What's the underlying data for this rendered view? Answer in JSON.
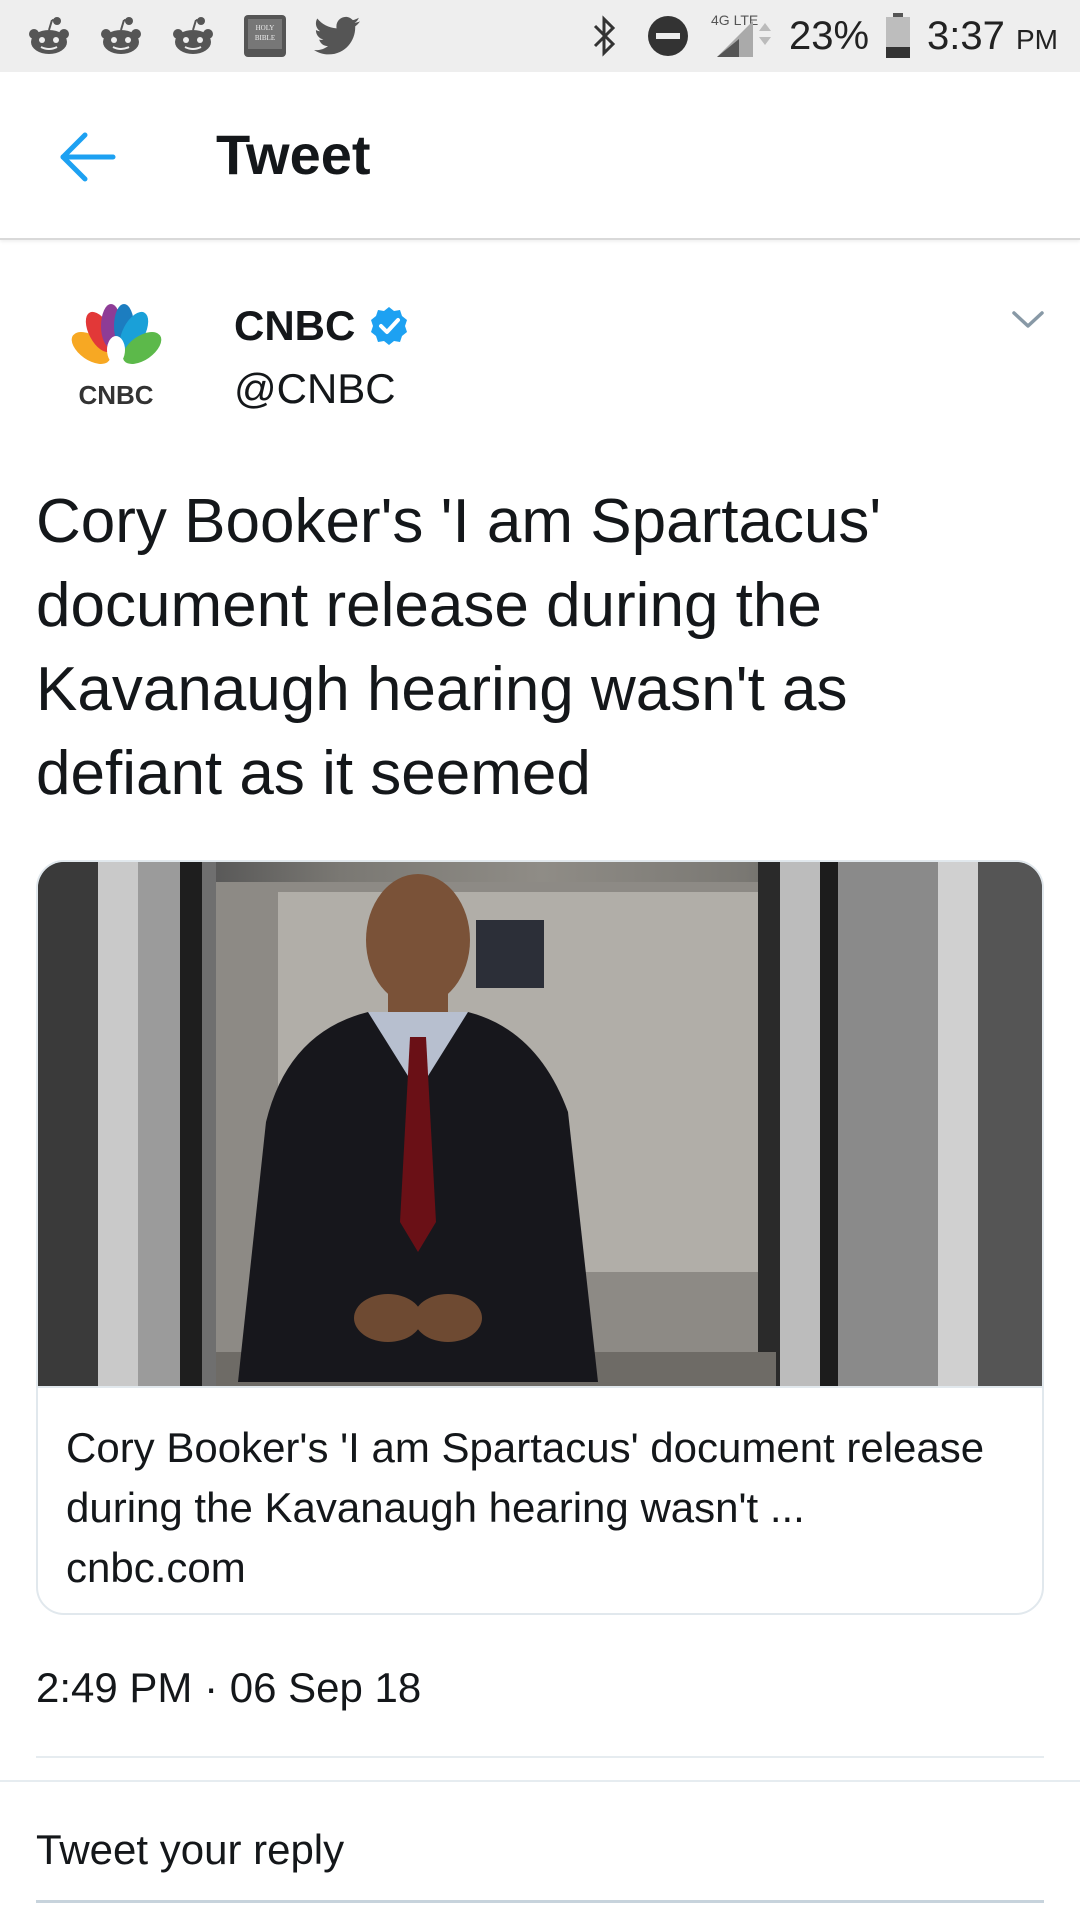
{
  "status_bar": {
    "left_icons": [
      "reddit-icon",
      "reddit-icon",
      "reddit-icon",
      "bible-icon",
      "twitter-icon"
    ],
    "bible_label": "HOLY BIBLE",
    "network": "4G LTE",
    "battery": "23%",
    "time": "3:37",
    "ampm": "PM"
  },
  "app_bar": {
    "title": "Tweet",
    "back_icon": "arrow-left-icon"
  },
  "tweet": {
    "author_name": "CNBC",
    "author_handle": "@CNBC",
    "verified": true,
    "avatar_logo_text": "CNBC",
    "text": "Cory Booker's 'I am Spartacus' document release during the Kavanaugh hearing wasn't as defiant as it seemed",
    "timestamp": "2:49 PM · 06 Sep 18"
  },
  "card": {
    "title": "Cory Booker's 'I am Spartacus' document release during the Kavanaugh hearing wasn't ...",
    "domain": "cnbc.com"
  },
  "reply": {
    "placeholder": "Tweet your reply"
  },
  "colors": {
    "accent": "#1da1f2",
    "text": "#14171a",
    "statusbar_bg": "#eeeeee",
    "divider": "#e6ecf0"
  }
}
